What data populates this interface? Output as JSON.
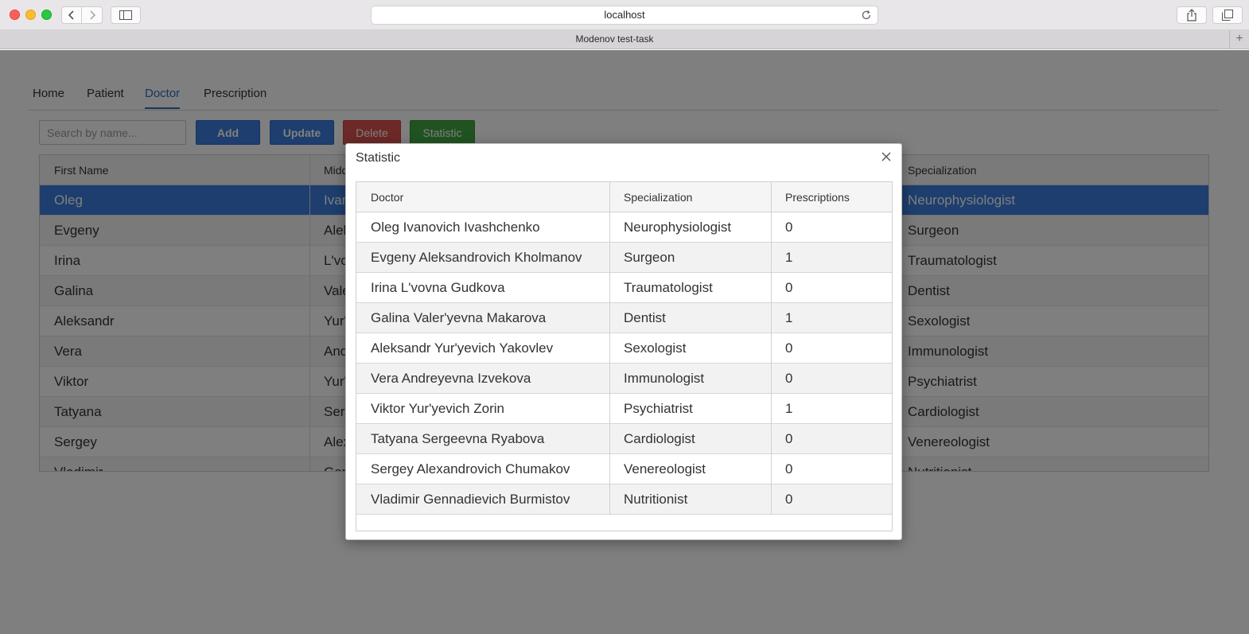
{
  "browser": {
    "address": "localhost",
    "tab_title": "Modenov test-task"
  },
  "nav": {
    "tabs": [
      {
        "label": "Home",
        "active": false
      },
      {
        "label": "Patient",
        "active": false
      },
      {
        "label": "Doctor",
        "active": true
      },
      {
        "label": "Prescription",
        "active": false
      }
    ]
  },
  "toolbar": {
    "search_placeholder": "Search by name...",
    "add_label": "Add",
    "update_label": "Update",
    "delete_label": "Delete",
    "statistic_label": "Statistic"
  },
  "doctor_grid": {
    "columns": [
      "First Name",
      "Midd",
      "Specialization"
    ],
    "rows": [
      {
        "first": "Oleg",
        "middle": "Ivan",
        "spec": "Neurophysiologist",
        "selected": true
      },
      {
        "first": "Evgeny",
        "middle": "Alek",
        "spec": "Surgeon"
      },
      {
        "first": "Irina",
        "middle": "L'vo",
        "spec": "Traumatologist"
      },
      {
        "first": "Galina",
        "middle": "Vale",
        "spec": "Dentist"
      },
      {
        "first": "Aleksandr",
        "middle": "Yur'",
        "spec": "Sexologist"
      },
      {
        "first": "Vera",
        "middle": "And",
        "spec": "Immunologist"
      },
      {
        "first": "Viktor",
        "middle": "Yur'",
        "spec": "Psychiatrist"
      },
      {
        "first": "Tatyana",
        "middle": "Serg",
        "spec": "Cardiologist"
      },
      {
        "first": "Sergey",
        "middle": "Alex",
        "spec": "Venereologist"
      },
      {
        "first": "Vladimir",
        "middle": "Gen",
        "spec": "Nutritionist"
      }
    ]
  },
  "modal": {
    "title": "Statistic",
    "columns": [
      "Doctor",
      "Specialization",
      "Prescriptions"
    ],
    "rows": [
      {
        "doctor": "Oleg Ivanovich Ivashchenko",
        "spec": "Neurophysiologist",
        "count": "0"
      },
      {
        "doctor": "Evgeny Aleksandrovich Kholmanov",
        "spec": "Surgeon",
        "count": "1"
      },
      {
        "doctor": "Irina L'vovna Gudkova",
        "spec": "Traumatologist",
        "count": "0"
      },
      {
        "doctor": "Galina Valer'yevna Makarova",
        "spec": "Dentist",
        "count": "1"
      },
      {
        "doctor": "Aleksandr Yur'yevich Yakovlev",
        "spec": "Sexologist",
        "count": "0"
      },
      {
        "doctor": "Vera Andreyevna Izvekova",
        "spec": "Immunologist",
        "count": "0"
      },
      {
        "doctor": "Viktor Yur'yevich Zorin",
        "spec": "Psychiatrist",
        "count": "1"
      },
      {
        "doctor": "Tatyana Sergeevna Ryabova",
        "spec": "Cardiologist",
        "count": "0"
      },
      {
        "doctor": "Sergey Alexandrovich Chumakov",
        "spec": "Venereologist",
        "count": "0"
      },
      {
        "doctor": "Vladimir Gennadievich Burmistov",
        "spec": "Nutritionist",
        "count": "0"
      }
    ]
  },
  "colors": {
    "accent": "#3b7ddd",
    "delete": "#d9534f",
    "statistic": "#43a643"
  }
}
